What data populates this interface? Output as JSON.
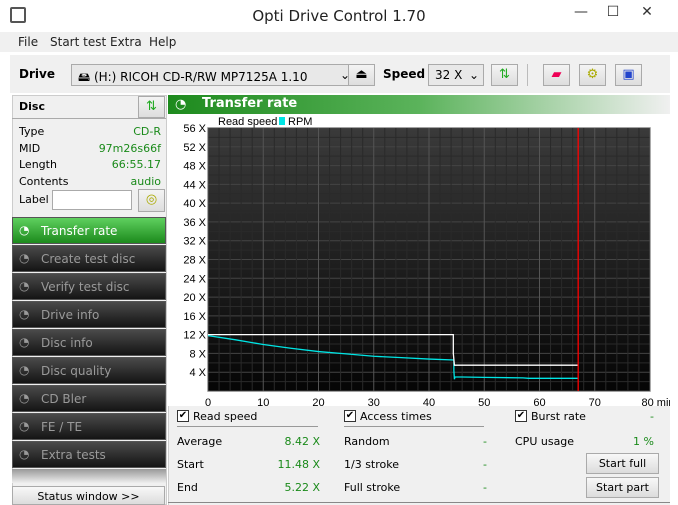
{
  "window": {
    "title": "Opti Drive Control 1.70",
    "minimize": "—",
    "maximize": "☐",
    "close": "✕"
  },
  "menu": [
    "File",
    "Start test",
    "Extra",
    "Help"
  ],
  "toolbar": {
    "drive_label": "Drive",
    "drive_value": "(H:)   RICOH CD-R/RW MP7125A 1.10",
    "speed_label": "Speed",
    "speed_value": "32 X"
  },
  "disc": {
    "header": "Disc",
    "rows": [
      {
        "k": "Type",
        "v": "CD-R"
      },
      {
        "k": "MID",
        "v": "97m26s66f"
      },
      {
        "k": "Length",
        "v": "66:55.17"
      },
      {
        "k": "Contents",
        "v": "audio"
      }
    ],
    "label_label": "Label",
    "label_value": ""
  },
  "nav": [
    "Transfer rate",
    "Create test disc",
    "Verify test disc",
    "Drive info",
    "Disc info",
    "Disc quality",
    "CD Bler",
    "FE / TE",
    "Extra tests"
  ],
  "status_button": "Status window >>",
  "panel_title": "Transfer rate",
  "chart_data": {
    "type": "line",
    "legend": [
      "Read speed",
      "RPM"
    ],
    "legend_color": "#00e5e5",
    "x_ticks": [
      "0",
      "10",
      "20",
      "30",
      "40",
      "50",
      "60",
      "70",
      "80 min"
    ],
    "y_ticks": [
      "4 X",
      "8 X",
      "12 X",
      "16 X",
      "20 X",
      "24 X",
      "28 X",
      "32 X",
      "36 X",
      "40 X",
      "44 X",
      "48 X",
      "52 X",
      "56 X"
    ],
    "xlim": [
      0,
      80
    ],
    "ylim": [
      0,
      56
    ],
    "series": [
      {
        "color": "#00e5e5",
        "points": [
          [
            0,
            11.8
          ],
          [
            5,
            10.9
          ],
          [
            10,
            9.9
          ],
          [
            15,
            9.1
          ],
          [
            20,
            8.4
          ],
          [
            25,
            7.9
          ],
          [
            30,
            7.4
          ],
          [
            35,
            7.1
          ],
          [
            40,
            6.8
          ],
          [
            44.5,
            6.6
          ],
          [
            44.5,
            4.4
          ],
          [
            44.6,
            2.5
          ],
          [
            44.7,
            3.0
          ],
          [
            50,
            2.9
          ],
          [
            57,
            2.8
          ],
          [
            58,
            2.7
          ],
          [
            67,
            2.7
          ]
        ]
      },
      {
        "color": "#ffffff",
        "points": [
          [
            0,
            12
          ],
          [
            44.4,
            12
          ],
          [
            44.4,
            8
          ],
          [
            44.6,
            5.5
          ],
          [
            55,
            5.5
          ],
          [
            67,
            5.5
          ]
        ]
      }
    ],
    "marker_x": 67,
    "marker_color": "#ff0000"
  },
  "stats": {
    "read_speed": {
      "label": "Read speed",
      "checked": true,
      "rows": [
        {
          "k": "Average",
          "v": "8.42 X"
        },
        {
          "k": "Start",
          "v": "11.48 X"
        },
        {
          "k": "End",
          "v": "5.22 X"
        }
      ]
    },
    "access": {
      "label": "Access times",
      "checked": true,
      "rows": [
        {
          "k": "Random",
          "v": "-"
        },
        {
          "k": "1/3 stroke",
          "v": "-"
        },
        {
          "k": "Full stroke",
          "v": "-"
        }
      ]
    },
    "burst": {
      "label": "Burst rate",
      "checked": true,
      "value": "-"
    },
    "cpu": {
      "label": "CPU usage",
      "value": "1 %"
    },
    "start_full": "Start full",
    "start_part": "Start part"
  }
}
